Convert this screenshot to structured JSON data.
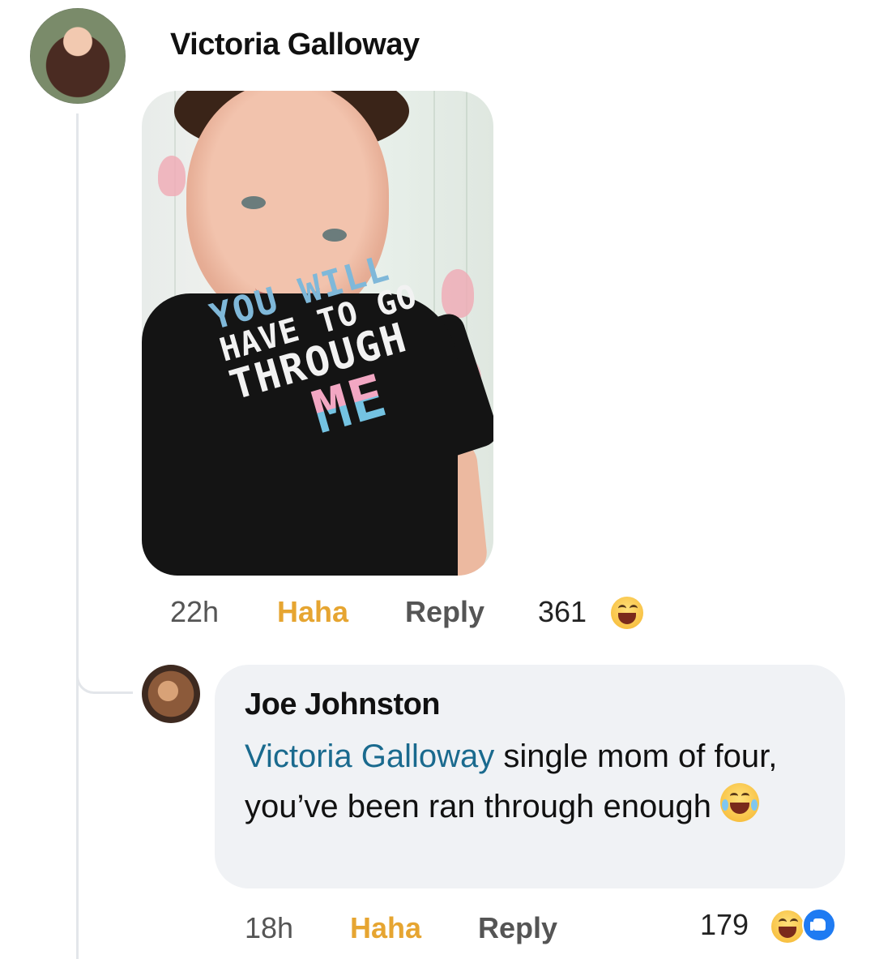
{
  "comment": {
    "author": "Victoria Galloway",
    "avatar_icon": "profile-avatar",
    "photo": {
      "shirt_text": [
        "YOU WILL",
        "HAVE TO GO",
        "THROUGH",
        "ME"
      ]
    },
    "time": "22h",
    "reaction_label": "Haha",
    "reply_label": "Reply",
    "reaction_count": "361",
    "reaction_icons": [
      "haha-icon"
    ]
  },
  "reply": {
    "author": "Joe Johnston",
    "avatar_icon": "profile-avatar",
    "mention": "Victoria Galloway",
    "text": " single mom of four, you’ve been ran through enough",
    "inline_emoji": "tears-of-joy-icon",
    "time": "18h",
    "reaction_label": "Haha",
    "reply_label": "Reply",
    "reaction_count": "179",
    "reaction_icons": [
      "haha-icon",
      "like-icon"
    ]
  },
  "colors": {
    "haha": "#e6a531",
    "mention": "#1a6a8e",
    "bubble": "#f0f2f5",
    "like": "#1f7bf2"
  }
}
